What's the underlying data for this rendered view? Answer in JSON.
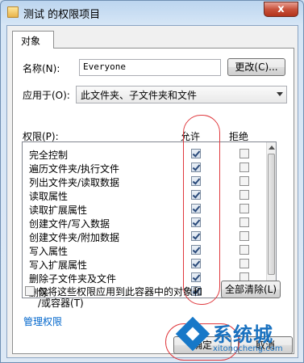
{
  "window": {
    "title": "测试 的权限项目",
    "close_label": "x"
  },
  "tab": {
    "label": "对象"
  },
  "name_row": {
    "label": "名称(N):",
    "value": "Everyone",
    "change_button": "更改(C)..."
  },
  "apply_row": {
    "label": "应用于(O):",
    "selected": "此文件夹、子文件夹和文件"
  },
  "permissions": {
    "header": "权限(P):",
    "allow_header": "允许",
    "deny_header": "拒绝",
    "items": [
      {
        "name": "完全控制",
        "allow": true,
        "deny": false
      },
      {
        "name": "遍历文件夹/执行文件",
        "allow": true,
        "deny": false
      },
      {
        "name": "列出文件夹/读取数据",
        "allow": true,
        "deny": false
      },
      {
        "name": "读取属性",
        "allow": true,
        "deny": false
      },
      {
        "name": "读取扩展属性",
        "allow": true,
        "deny": false
      },
      {
        "name": "创建文件/写入数据",
        "allow": true,
        "deny": false
      },
      {
        "name": "创建文件夹/附加数据",
        "allow": true,
        "deny": false
      },
      {
        "name": "写入属性",
        "allow": true,
        "deny": false
      },
      {
        "name": "写入扩展属性",
        "allow": true,
        "deny": false
      },
      {
        "name": "删除子文件夹及文件",
        "allow": true,
        "deny": false
      },
      {
        "name": "删除",
        "allow": true,
        "deny": false
      }
    ]
  },
  "apply_only": {
    "label_line1": "仅将这些权限应用到此容器中的对象和",
    "label_line2": "/或容器(T)",
    "checked": false
  },
  "clear_all_button": "全部清除(L)",
  "manage_link": "管理权限",
  "footer": {
    "ok_button": "确定",
    "cancel_button": "取消"
  },
  "watermark": {
    "brand": "系统城",
    "url": "xitongcheng.com"
  },
  "colors": {
    "annotation": "#e0393e",
    "link": "#0066cc",
    "brand_blue": "#1a72c0"
  }
}
